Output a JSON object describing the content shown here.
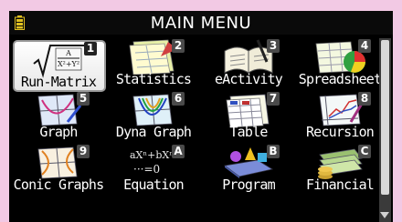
{
  "header": {
    "title": "MAIN MENU"
  },
  "icons": {
    "battery": "battery-icon"
  },
  "tiles": [
    {
      "label": "Run-Matrix",
      "key": "1",
      "icon": "run-matrix-icon",
      "selected": true
    },
    {
      "label": "Statistics",
      "key": "2",
      "icon": "statistics-icon"
    },
    {
      "label": "eActivity",
      "key": "3",
      "icon": "eactivity-icon"
    },
    {
      "label": "Spreadsheet",
      "key": "4",
      "icon": "spreadsheet-icon"
    },
    {
      "label": "Graph",
      "key": "5",
      "icon": "graph-icon"
    },
    {
      "label": "Dyna Graph",
      "key": "6",
      "icon": "dyna-graph-icon"
    },
    {
      "label": "Table",
      "key": "7",
      "icon": "table-icon"
    },
    {
      "label": "Recursion",
      "key": "8",
      "icon": "recursion-icon"
    },
    {
      "label": "Conic Graphs",
      "key": "9",
      "icon": "conic-graphs-icon"
    },
    {
      "label": "Equation",
      "key": "A",
      "icon": "equation-icon"
    },
    {
      "label": "Program",
      "key": "B",
      "icon": "program-icon"
    },
    {
      "label": "Financial",
      "key": "C",
      "icon": "financial-icon"
    }
  ],
  "art_text": {
    "run_matrix_A": "A",
    "run_matrix_XY": "X²+Y²",
    "equation_top": "aXⁿ+bXⁿ⁻¹",
    "equation_bottom": "···=0"
  },
  "colors": {
    "background": "#f2c9e4",
    "screen": "#000000",
    "key_badge": "#4a4a4a"
  }
}
